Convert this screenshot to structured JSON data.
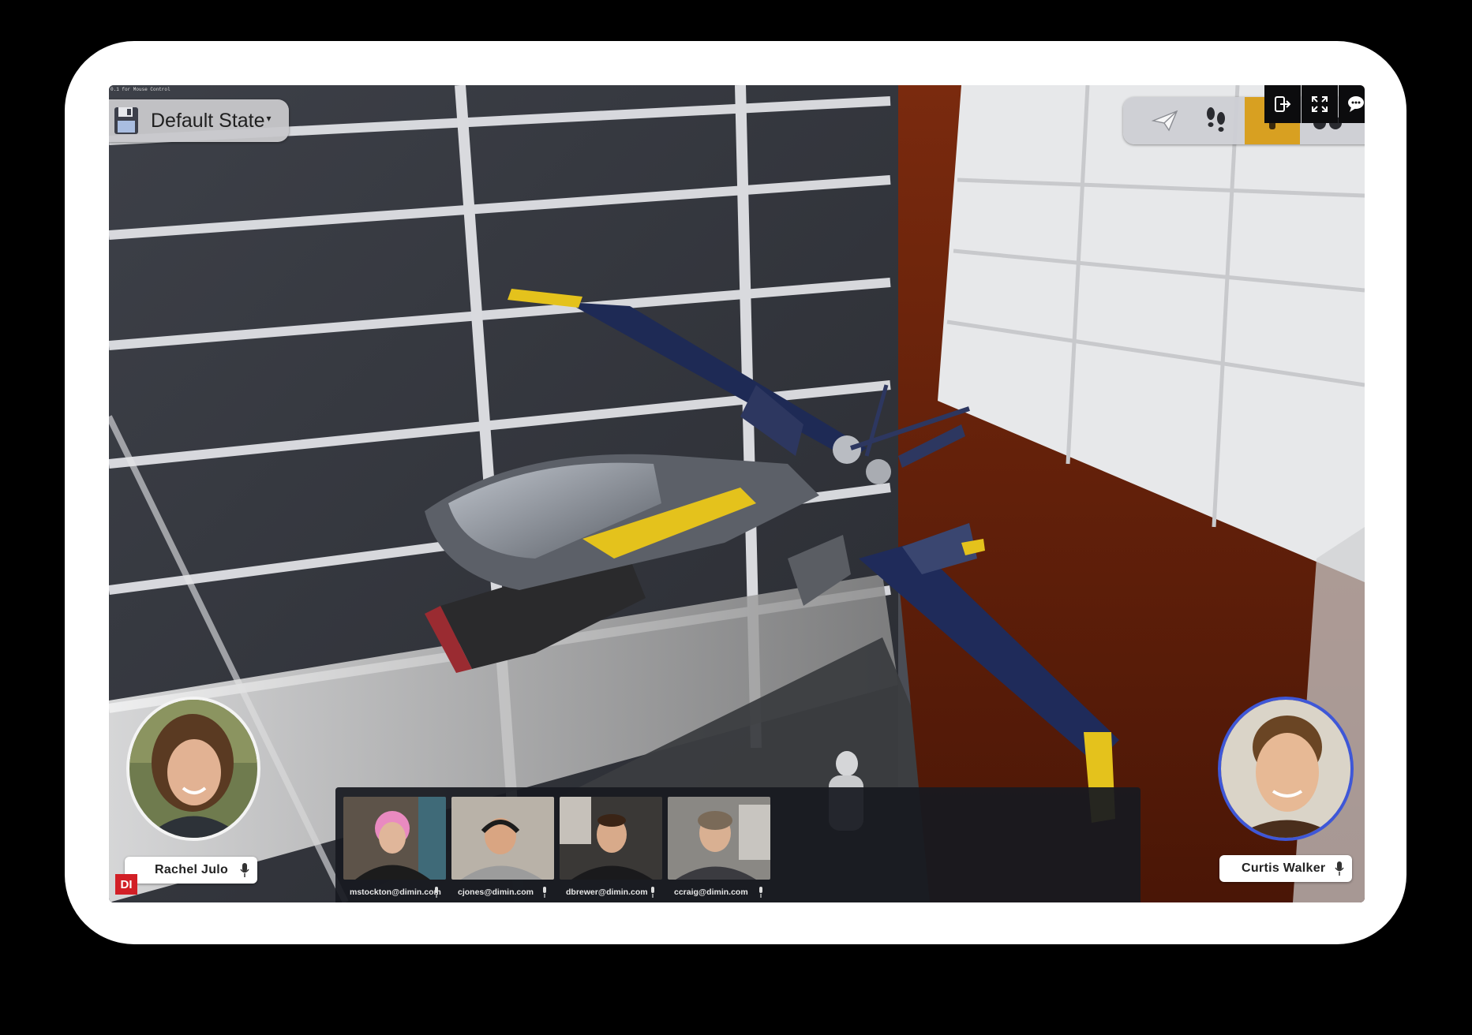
{
  "app": {
    "debug_text": "0.1 for Mouse Control",
    "logo": "DI"
  },
  "state_selector": {
    "label": "Default State",
    "icon": "floppy-disk-icon"
  },
  "toolbar": {
    "tools": [
      {
        "name": "send",
        "icon": "paper-plane-icon"
      },
      {
        "name": "walk",
        "icon": "footsteps-icon"
      },
      {
        "name": "active-tool",
        "icon": "tool-icon",
        "active": true
      },
      {
        "name": "extra",
        "icon": "binoculars-icon"
      }
    ],
    "active_color": "#d8a021",
    "corner_buttons": [
      "exit-icon",
      "fullscreen-icon",
      "chat-icon"
    ]
  },
  "presenters": [
    {
      "name": "Rachel Julo",
      "ring_color": "#f4f4f4",
      "mic": "microphone-icon"
    },
    {
      "name": "Curtis Walker",
      "ring_color": "#3e57d8",
      "mic": "microphone-icon"
    }
  ],
  "participants": [
    {
      "email": "mstockton@dimin.com"
    },
    {
      "email": "cjones@dimin.com"
    },
    {
      "email": "dbrewer@dimin.com"
    },
    {
      "email": "ccraig@dimin.com"
    }
  ]
}
